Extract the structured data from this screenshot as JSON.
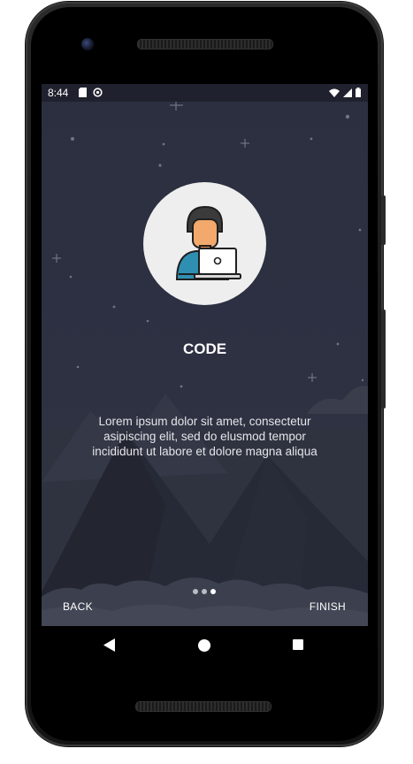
{
  "status_bar": {
    "time": "8:44",
    "left_icons": [
      "sd-card-icon",
      "sync-circle-icon"
    ],
    "right_icons": [
      "wifi-icon",
      "cell-signal-icon",
      "battery-icon"
    ]
  },
  "onboarding": {
    "illustration": "developer-with-laptop-icon",
    "title": "CODE",
    "description": "Lorem ipsum dolor sit amet, consectetur asipiscing elit, sed do elusmod tempor incididunt ut labore et dolore magna aliqua",
    "page_count": 3,
    "current_page": 3,
    "back_label": "BACK",
    "finish_label": "FINISH"
  },
  "navigation": {
    "buttons": [
      "back-triangle-icon",
      "home-circle-icon",
      "recents-square-icon"
    ]
  },
  "colors": {
    "screen_bg": "#2d3142",
    "status_bar_bg": "#1f222e",
    "avatar_bg": "#eeeeee",
    "text": "#ffffff"
  }
}
